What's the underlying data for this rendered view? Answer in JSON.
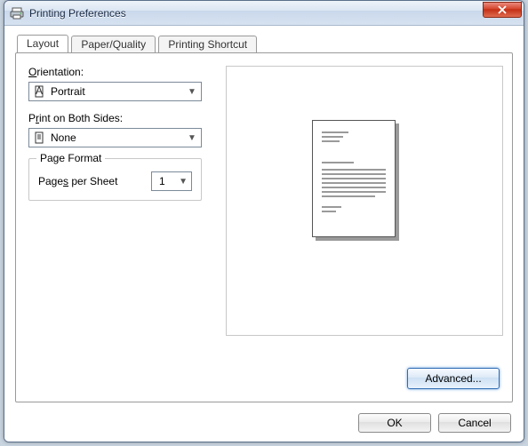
{
  "window": {
    "title": "Printing Preferences"
  },
  "tabs": {
    "layout": "Layout",
    "paper": "Paper/Quality",
    "shortcut": "Printing Shortcut"
  },
  "orientation": {
    "label_pre": "",
    "label_u": "O",
    "label_post": "rientation:",
    "value": "Portrait"
  },
  "duplex": {
    "label_pre": "P",
    "label_u": "r",
    "label_post": "int on Both Sides:",
    "value": "None"
  },
  "pageformat": {
    "legend": "Page Format",
    "pps_pre": "Page",
    "pps_u": "s",
    "pps_post": " per Sheet",
    "pps_value": "1"
  },
  "buttons": {
    "advanced": "Advanced...",
    "ok": "OK",
    "cancel": "Cancel"
  }
}
